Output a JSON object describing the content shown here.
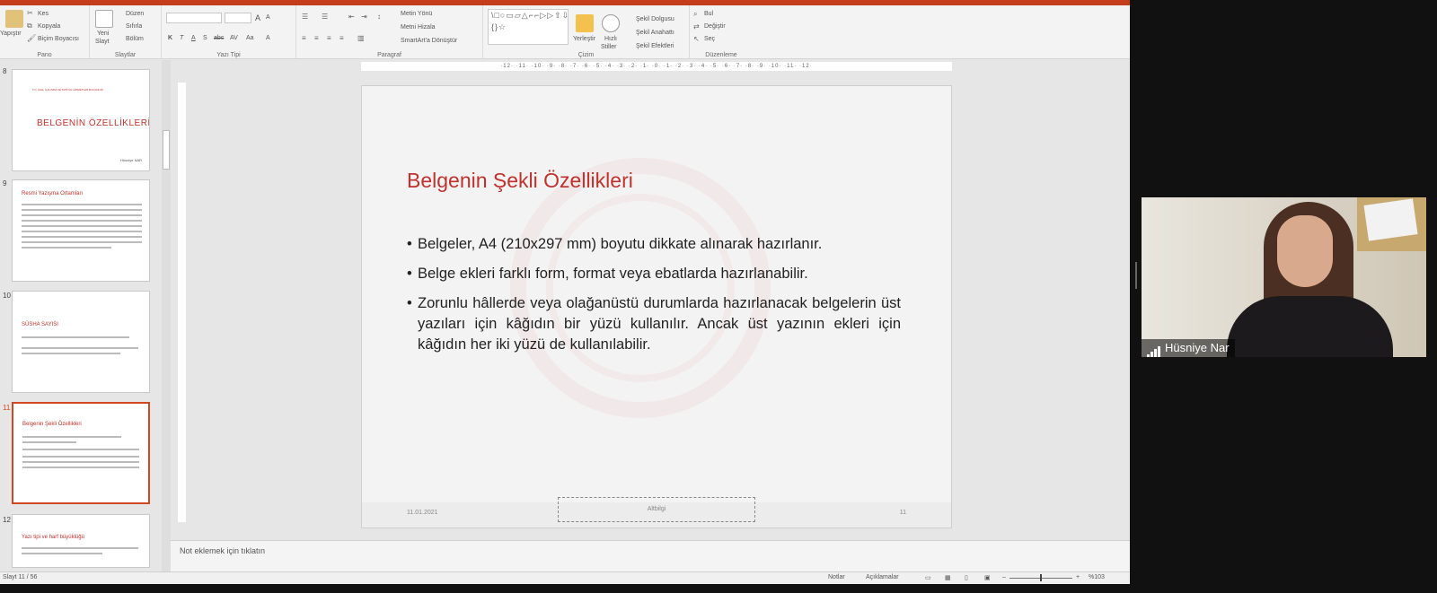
{
  "ribbon": {
    "clipboard": {
      "paste": "Yapıştır",
      "cut": "Kes",
      "copy": "Kopyala",
      "format_painter": "Biçim Boyacısı",
      "group": "Pano"
    },
    "slides": {
      "new_slide_1": "Yeni",
      "new_slide_2": "Slayt",
      "layout": "Düzen",
      "reset": "Sıfırla",
      "section": "Bölüm",
      "group": "Slaytlar"
    },
    "font": {
      "font_size_up": "A",
      "font_size_down": "A",
      "bold": "K",
      "italic": "T",
      "underline": "A",
      "shadow": "S",
      "strike": "abc",
      "spacing": "AV",
      "case": "Aa",
      "color": "A",
      "group": "Yazı Tipi"
    },
    "paragraph": {
      "text_direction": "Metin Yönü",
      "align_text": "Metni Hizala",
      "smartart": "SmartArt'a Dönüştür",
      "group": "Paragraf"
    },
    "drawing": {
      "shapes_glyphs": "\\□○▭▱△⌐⌐▷▷⇧⇩↻ {}☆",
      "arrange_1": "Yerleştir",
      "quick_styles_1": "Hızlı",
      "quick_styles_2": "Stiller",
      "shape_fill": "Şekil Dolgusu",
      "shape_outline": "Şekil Anahattı",
      "shape_effects": "Şekil Efektleri",
      "group": "Çizim"
    },
    "editing": {
      "find": "Bul",
      "replace": "Değiştir",
      "select": "Seç",
      "group": "Düzenleme"
    }
  },
  "thumbnails": [
    {
      "number": "8",
      "title": "BELGENİN ÖZELLİKLERİ",
      "subtitle": "T.C. AİLE, ÇALIŞMA VE SOSYAL HİZMETLER BAKANLIĞI",
      "author": "Hüsniye NAR"
    },
    {
      "number": "9",
      "title": "Resmi Yazışma Ortamları"
    },
    {
      "number": "10",
      "title": "SÜSHA SAYISI"
    },
    {
      "number": "11",
      "title": "Belgenin Şekli Özellikleri",
      "selected": true
    },
    {
      "number": "12",
      "title": "Yazı tipi ve harf büyüklüğü"
    }
  ],
  "ruler": {
    "marks": "·12· ·11· ·10· ·9· ·8· ·7· ·6· ·5· ·4· ·3· ·2· ·1· ·0· ·1· ·2· ·3· ·4· ·5· ·6· ·7· ·8· ·9· ·10· ·11· ·12·"
  },
  "slide": {
    "title": "Belgenin Şekli Özellikleri",
    "bullets": [
      "Belgeler, A4 (210x297 mm) boyutu dikkate alınarak hazırlanır.",
      "Belge ekleri farklı form, format veya ebatlarda hazırlanabilir.",
      "Zorunlu hâllerde veya olağanüstü durumlarda hazırlanacak belgelerin üst yazıları için kâğıdın bir yüzü kullanılır. Ancak üst yazının ekleri için kâğıdın her iki yüzü de kullanılabilir."
    ],
    "footer_date": "11.01.2021",
    "footer_text": "Altbilgi",
    "footer_number": "11"
  },
  "notes": {
    "placeholder": "Not eklemek için tıklatın"
  },
  "status": {
    "slide_counter": "Slayt 11 / 56",
    "notes_button": "Notlar",
    "comments_button": "Açıklamalar",
    "zoom_minus": "–",
    "zoom_plus": "+",
    "zoom": "%103"
  },
  "video": {
    "participant_name": "Hüsniye Nar"
  },
  "colors": {
    "accent": "#c43e1c",
    "slide_title": "#c0322b",
    "selected_thumb": "#d0481f"
  }
}
